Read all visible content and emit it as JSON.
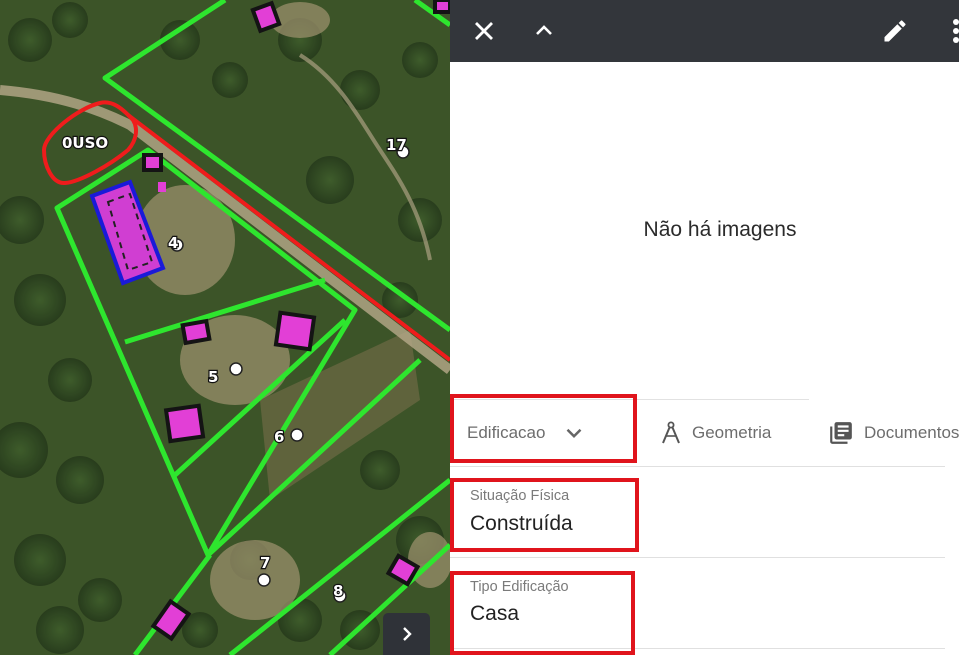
{
  "map": {
    "parcel_labels": [
      "4",
      "5",
      "6",
      "7",
      "8",
      "17"
    ],
    "zone_label": "0USO",
    "colors": {
      "parcel_boundary": "#2ee62e",
      "road_line": "#ef1c1c",
      "selected_building": "#1a1ad8",
      "building_fill": "#e23fd6"
    },
    "expand_icon": "chevron-right-icon"
  },
  "toolbar": {
    "close_icon": "close-icon",
    "collapse_icon": "chevron-up-icon",
    "edit_icon": "pencil-icon",
    "more_icon": "more-vert-icon"
  },
  "images": {
    "empty_text": "Não há imagens"
  },
  "tabs": [
    {
      "label": "Edificacao",
      "icon": "chevron-down-icon"
    },
    {
      "label": "Geometria",
      "icon": "compass-icon"
    },
    {
      "label": "Documentos",
      "icon": "library-books-icon"
    }
  ],
  "fields": [
    {
      "label": "Situação Física",
      "value": "Construída"
    },
    {
      "label": "Tipo Edificação",
      "value": "Casa"
    }
  ],
  "highlight_color": "#e0141c"
}
